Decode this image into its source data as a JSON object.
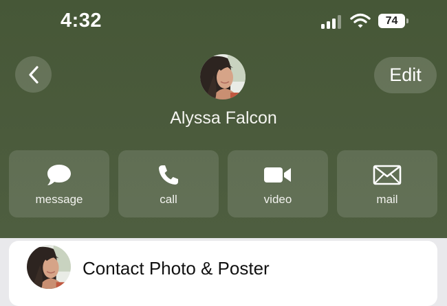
{
  "status_bar": {
    "time": "4:32",
    "battery": "74",
    "signal_icon": "cellular-signal-icon",
    "wifi_icon": "wifi-icon"
  },
  "header": {
    "back_icon": "chevron-left-icon",
    "edit_label": "Edit",
    "contact_name": "Alyssa Falcon",
    "background_color": "#4a5a3b"
  },
  "actions": [
    {
      "label": "message",
      "icon": "message-bubble-icon"
    },
    {
      "label": "call",
      "icon": "phone-icon"
    },
    {
      "label": "video",
      "icon": "video-camera-icon"
    },
    {
      "label": "mail",
      "icon": "envelope-icon"
    }
  ],
  "contact_photo_row": {
    "label": "Contact Photo & Poster"
  }
}
